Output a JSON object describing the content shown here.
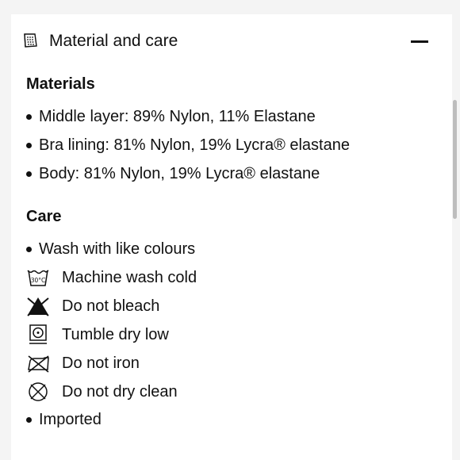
{
  "header": {
    "title": "Material and care",
    "icon": "fabric-swatch-icon",
    "toggle_icon": "minus-icon"
  },
  "materials": {
    "heading": "Materials",
    "items": [
      "Middle layer: 89% Nylon, 11% Elastane",
      "Bra lining: 81% Nylon, 19% Lycra® elastane",
      "Body: 81% Nylon, 19% Lycra® elastane"
    ]
  },
  "care": {
    "heading": "Care",
    "intro": "Wash with like colours",
    "instructions": [
      {
        "icon": "machine-wash-30c-icon",
        "icon_text": "30°C",
        "label": "Machine wash cold"
      },
      {
        "icon": "do-not-bleach-icon",
        "label": "Do not bleach"
      },
      {
        "icon": "tumble-dry-low-icon",
        "label": "Tumble dry low"
      },
      {
        "icon": "do-not-iron-icon",
        "label": "Do not iron"
      },
      {
        "icon": "do-not-dry-clean-icon",
        "label": "Do not dry clean"
      }
    ],
    "outro": "Imported"
  }
}
